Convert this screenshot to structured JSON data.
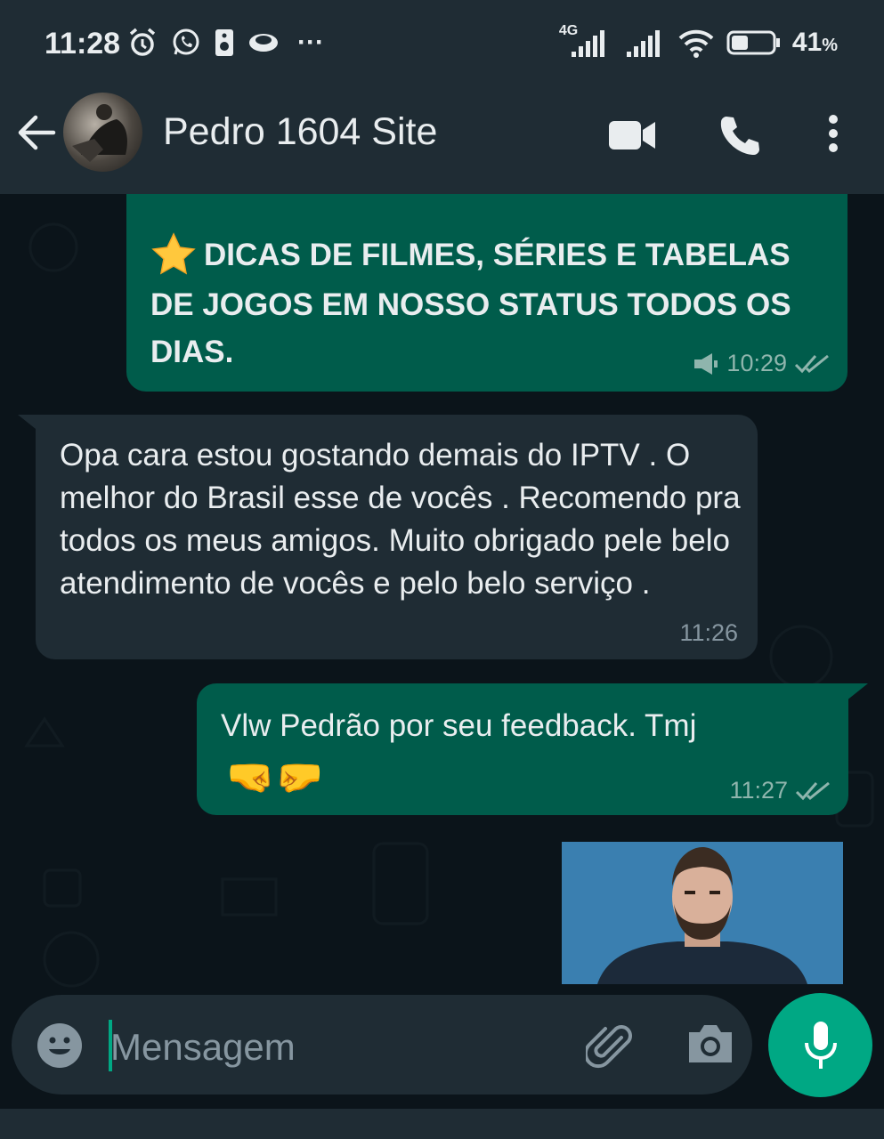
{
  "status_bar": {
    "time": "11:28",
    "network_label": "4G",
    "battery_percent": "41",
    "battery_unit": "%",
    "overflow_indicator": "···",
    "battery_level": 0.41,
    "icons": [
      "alarm-icon",
      "whatsapp-icon",
      "speaker-icon",
      "eye-icon",
      "signal-icon",
      "wifi-icon",
      "battery-icon"
    ]
  },
  "header": {
    "contact_name": "Pedro 1604 Site",
    "icons": [
      "back-arrow-icon",
      "video-call-icon",
      "phone-call-icon",
      "more-options-icon"
    ]
  },
  "messages": [
    {
      "direction": "outgoing",
      "emoji": "⭐",
      "text": "DICAS DE FILMES, SÉRIES E TABELAS DE JOGOS EM NOSSO STATUS TODOS OS DIAS.",
      "time": "10:29",
      "status": "read",
      "icons": [
        "broadcast-icon",
        "double-check-icon"
      ]
    },
    {
      "direction": "incoming",
      "text": "Opa cara estou gostando demais do IPTV . O melhor do Brasil esse de vocês . Recomendo pra todos os meus amigos. Muito obrigado pele belo atendimento de vocês e pelo belo serviço .",
      "time": "11:26"
    },
    {
      "direction": "outgoing",
      "text": "Vlw Pedrão por seu feedback. Tmj",
      "emoji": "🤜🤛",
      "time": "11:27",
      "status": "read",
      "icons": [
        "double-check-icon"
      ]
    },
    {
      "direction": "outgoing",
      "type": "sticker"
    }
  ],
  "composer": {
    "placeholder": "Mensagem",
    "icons": [
      "emoji-icon",
      "attach-icon",
      "camera-icon",
      "microphone-icon"
    ]
  },
  "colors": {
    "header_bg": "#1f2c34",
    "chat_bg": "#0b141a",
    "outgoing_bubble": "#005c4b",
    "incoming_bubble": "#1f2c34",
    "accent": "#00a884",
    "text_primary": "#e9edef",
    "read_check": "#8fb5ad"
  }
}
